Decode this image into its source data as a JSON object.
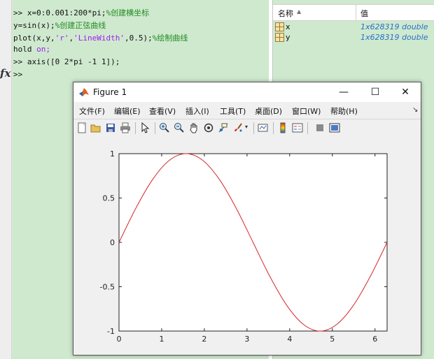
{
  "command_window": {
    "lines": [
      {
        "prompt": ">> ",
        "code": "x=0:0.001:200*pi;",
        "comment": "%创建横坐标"
      },
      {
        "code": "y=sin(x);",
        "comment": "%创建正弦曲线"
      },
      {
        "code_pre": "plot(x,y,",
        "str1": "'r'",
        "code_mid": ",",
        "str2": "'LineWidth'",
        "code_post": ",0.5);",
        "comment": "%绘制曲线"
      },
      {
        "code": "hold ",
        "keyword": "on;"
      },
      {
        "prompt": ">> ",
        "code": "axis([0 2*pi -1 1]);"
      }
    ],
    "active_prompt": ">>",
    "fx_label": "fx"
  },
  "workspace": {
    "col_name": "名称",
    "sort_arrow": "▲",
    "col_value": "值",
    "variables": [
      {
        "name": "x",
        "value": "1x628319 double"
      },
      {
        "name": "y",
        "value": "1x628319 double"
      }
    ]
  },
  "figure": {
    "title": "Figure 1",
    "menu": [
      "文件(F)",
      "编辑(E)",
      "查看(V)",
      "插入(I)",
      "工具(T)",
      "桌面(D)",
      "窗口(W)",
      "帮助(H)"
    ],
    "menu_arrow": "↘",
    "window_buttons": {
      "minimize": "—",
      "maximize": "☐",
      "close": "✕"
    },
    "toolbar_icons": [
      "new-figure-icon",
      "open-file-icon",
      "save-icon",
      "print-icon",
      "pointer-icon",
      "zoom-in-icon",
      "zoom-out-icon",
      "pan-hand-icon",
      "rotate-3d-icon",
      "data-cursor-icon",
      "brush-icon",
      "link-plot-icon",
      "colorbar-icon",
      "legend-icon",
      "hide-plot-tools-icon",
      "show-plot-tools-icon"
    ]
  },
  "chart_data": {
    "type": "line",
    "title": "",
    "xlabel": "",
    "ylabel": "",
    "xlim": [
      0,
      6.2832
    ],
    "ylim": [
      -1,
      1
    ],
    "xticks": [
      0,
      1,
      2,
      3,
      4,
      5,
      6
    ],
    "xtick_labels": [
      "0",
      "1",
      "2",
      "3",
      "4",
      "5",
      "6"
    ],
    "yticks": [
      1,
      0.5,
      0,
      -0.5,
      -1
    ],
    "ytick_labels": [
      "1",
      "0.5",
      "0",
      "-0.5",
      "-1"
    ],
    "series": [
      {
        "color": "#d62728",
        "line_width": 0.5,
        "x": [
          0,
          0.3927,
          0.7854,
          1.1781,
          1.5708,
          1.9635,
          2.3562,
          2.7489,
          3.1416,
          3.5343,
          3.927,
          4.3197,
          4.7124,
          5.1051,
          5.4978,
          5.8905,
          6.2832
        ],
        "y": [
          0,
          0.383,
          0.707,
          0.924,
          1,
          0.924,
          0.707,
          0.383,
          0,
          -0.383,
          -0.707,
          -0.924,
          -1,
          -0.924,
          -0.707,
          -0.383,
          0
        ]
      }
    ],
    "grid": false,
    "colors": {
      "line": "#d62728",
      "axes_bg": "#ffffff",
      "figure_bg": "#f0f0f0"
    }
  }
}
